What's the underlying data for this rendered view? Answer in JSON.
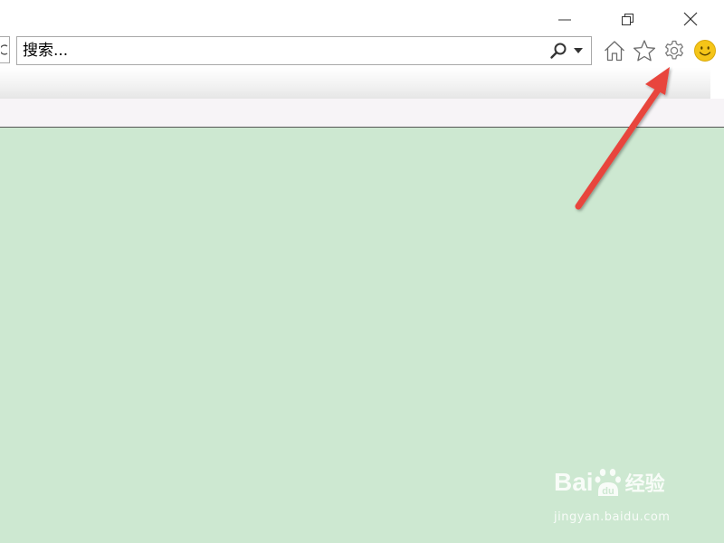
{
  "window": {
    "minimize_icon": "minimize-icon",
    "restore_icon": "restore-icon",
    "close_icon": "close-icon"
  },
  "toolbar": {
    "back_icon": "back-arrow-icon",
    "search": {
      "placeholder": "搜索...",
      "value": "",
      "go_icon": "search-icon",
      "dropdown_icon": "dropdown-arrow-icon"
    },
    "icons": [
      "home-icon",
      "favorites-star-icon",
      "gear-icon",
      "smiley-feedback-icon"
    ]
  },
  "content": {
    "background_color": "#cde8d1"
  },
  "annotation": {
    "arrow_color": "#e8453c",
    "target": "gear-icon"
  },
  "watermark": {
    "brand_prefix": "Bai",
    "brand_suffix": "经验",
    "url": "jingyan.baidu.com"
  },
  "colors": {
    "gear_accent": "#8a8a8a",
    "smiley": "#f5c518"
  }
}
